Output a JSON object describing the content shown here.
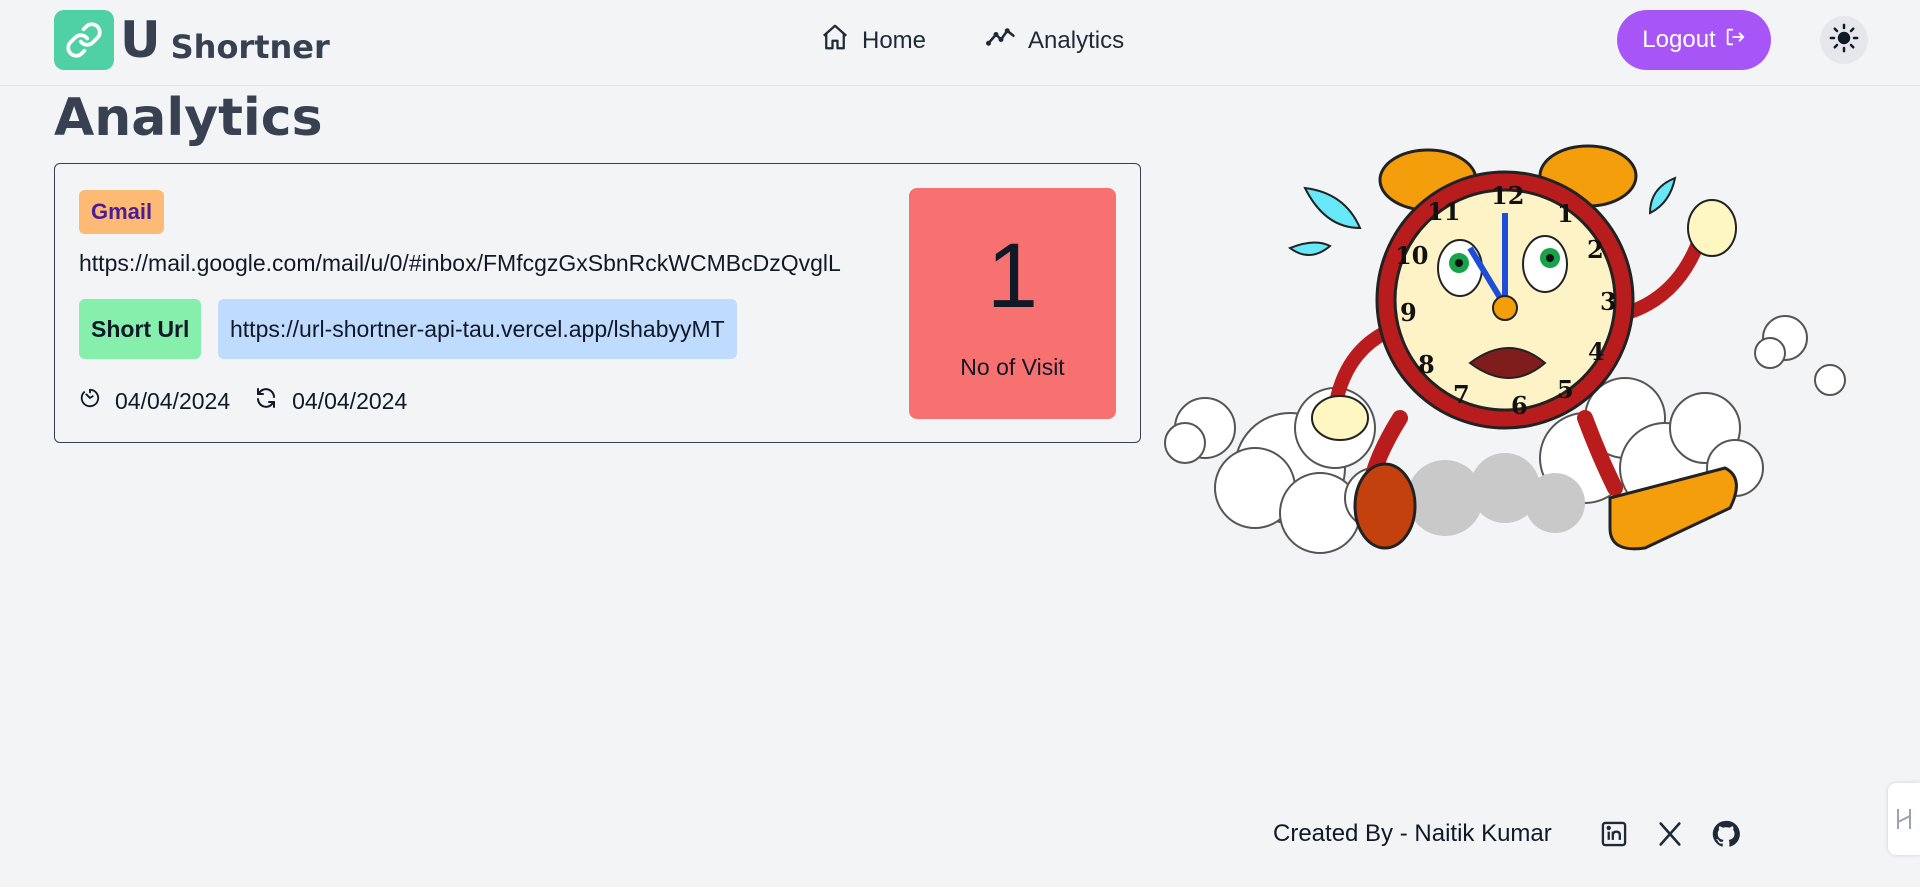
{
  "brand": {
    "letter": "U",
    "name": "Shortner"
  },
  "nav": {
    "home": "Home",
    "analytics": "Analytics"
  },
  "header": {
    "logout": "Logout"
  },
  "page": {
    "title": "Analytics"
  },
  "card": {
    "tag": "Gmail",
    "original_url": "https://mail.google.com/mail/u/0/#inbox/FMfcgzGxSbnRckWCMBcDzQvglL",
    "short_label": "Short Url",
    "short_url": "https://url-shortner-api-tau.vercel.app/lshabyyMT",
    "created_date": "04/04/2024",
    "updated_date": "04/04/2024",
    "visit_count": "1",
    "visit_label": "No of Visit"
  },
  "footer": {
    "credit": "Created By - Naitik Kumar"
  },
  "colors": {
    "brand_green": "#4fd1a5",
    "logout_purple": "#a855f7",
    "tag_orange": "#fdba74",
    "short_green": "#86efac",
    "short_blue": "#bfdbfe",
    "visit_red": "#f87171"
  },
  "icons": [
    "link-icon",
    "home-icon",
    "trend-icon",
    "logout-icon",
    "sun-icon",
    "clock-icon",
    "refresh-icon",
    "linkedin-icon",
    "x-icon",
    "github-icon"
  ]
}
